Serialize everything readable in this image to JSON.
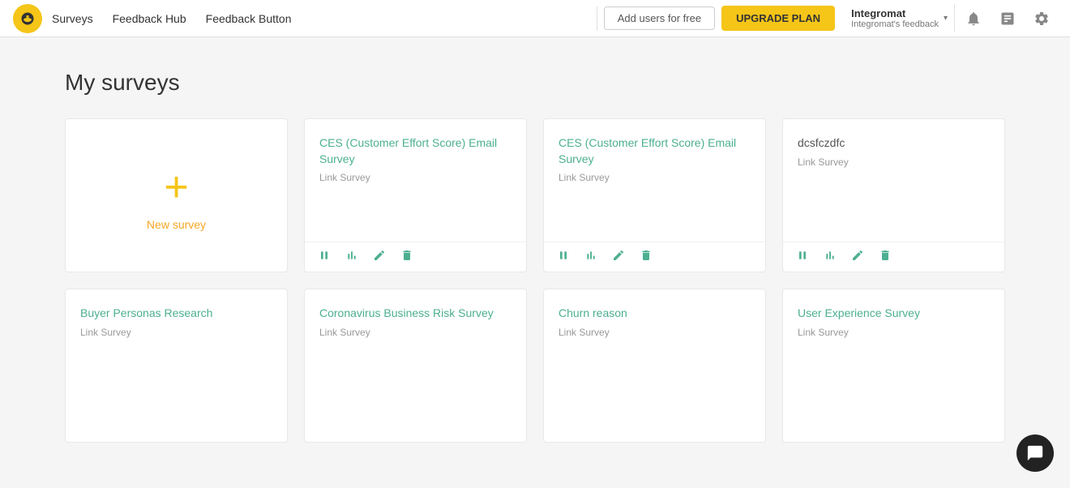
{
  "navbar": {
    "logo_alt": "Survicate logo",
    "nav_items": [
      {
        "label": "Surveys",
        "id": "surveys"
      },
      {
        "label": "Feedback Hub",
        "id": "feedback-hub"
      },
      {
        "label": "Feedback Button",
        "id": "feedback-button"
      }
    ],
    "add_users_label": "Add users for free",
    "upgrade_label": "UPGRADE PLAN",
    "account": {
      "name": "Integromat",
      "sub": "Integromat's feedback"
    },
    "icons": {
      "bell": "🔔",
      "pages": "📋",
      "gear": "⚙"
    }
  },
  "page": {
    "title": "My surveys"
  },
  "new_survey": {
    "label": "New survey"
  },
  "surveys_row1": [
    {
      "title": "CES (Customer Effort Score) Email Survey",
      "type": "Link Survey"
    },
    {
      "title": "CES (Customer Effort Score) Email Survey",
      "type": "Link Survey"
    },
    {
      "title": "dcsfczdfc",
      "type": "Link Survey"
    }
  ],
  "surveys_row2": [
    {
      "title": "Buyer Personas Research",
      "type": "Link Survey"
    },
    {
      "title": "Coronavirus Business Risk Survey",
      "type": "Link Survey"
    },
    {
      "title": "Churn reason",
      "type": "Link Survey"
    },
    {
      "title": "User Experience Survey",
      "type": "Link Survey"
    }
  ],
  "card_icons": {
    "pause": "⏸",
    "bar_chart": "📊",
    "edit": "✎",
    "trash": "🗑"
  }
}
